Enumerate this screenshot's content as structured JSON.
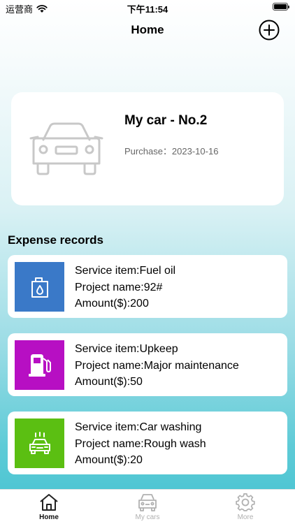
{
  "status_bar": {
    "carrier": "运营商",
    "time": "下午11:54",
    "battery_level": 1.0
  },
  "header": {
    "title": "Home",
    "add_icon": "plus-circle-icon"
  },
  "car": {
    "name": "My car - No.2",
    "purchase_label": "Purchase：",
    "purchase_date": "2023-10-16",
    "image_icon": "car-outline-icon"
  },
  "expenses": {
    "section_title": "Expense records",
    "records": [
      {
        "service": "Service item:Fuel oil",
        "project": "Project name:92#",
        "amount": "Amount($):200",
        "icon": "oil-can-icon",
        "color": "#3a79c8"
      },
      {
        "service": "Service item:Upkeep",
        "project": "Project name:Major maintenance",
        "amount": "Amount($):50",
        "icon": "fuel-pump-icon",
        "color": "#b70fc3"
      },
      {
        "service": "Service item:Car washing",
        "project": "Project name:Rough wash",
        "amount": "Amount($):20",
        "icon": "car-wash-icon",
        "color": "#5bbf12"
      }
    ]
  },
  "tabs": [
    {
      "label": "Home",
      "icon": "home-icon",
      "active": true
    },
    {
      "label": "My cars",
      "icon": "car-icon",
      "active": false
    },
    {
      "label": "More",
      "icon": "gear-icon",
      "active": false
    }
  ]
}
